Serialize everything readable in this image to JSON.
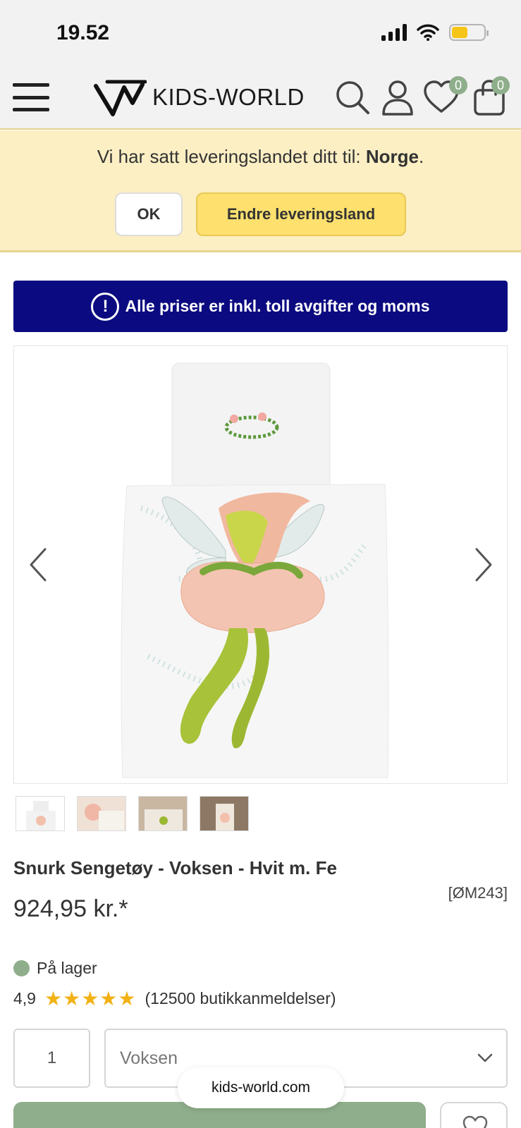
{
  "status_bar": {
    "time": "19.52"
  },
  "header": {
    "logo_text": "KIDS-WORLD",
    "wishlist_count": "0",
    "cart_count": "0",
    "icons": [
      "menu-icon",
      "search-icon",
      "user-icon",
      "heart-icon",
      "bag-icon"
    ]
  },
  "delivery_banner": {
    "text_prefix": "Vi har satt leveringslandet ditt til: ",
    "country": "Norge",
    "text_suffix": ".",
    "ok_label": "OK",
    "change_label": "Endre leveringsland"
  },
  "info_bar": {
    "icon_text": "!",
    "text": "Alle priser er inkl. toll avgifter og moms"
  },
  "product": {
    "title": "Snurk Sengetøy - Voksen - Hvit m. Fe",
    "sku": "[ØM243]",
    "price": "924,95 kr.*",
    "stock_status": "På lager",
    "rating_value": "4,9",
    "rating_stars": 5,
    "stars_text": "★★★★★",
    "review_count_text": "(12500 butikkanmeldelser)",
    "quantity": "1",
    "variant": "Voksen"
  },
  "browser": {
    "url": "kids-world.com"
  },
  "colors": {
    "banner_bg": "#fcefc4",
    "change_button": "#fde06e",
    "info_bar": "#0b0a80",
    "badge": "#8fae8b",
    "stars": "#f2b215"
  }
}
